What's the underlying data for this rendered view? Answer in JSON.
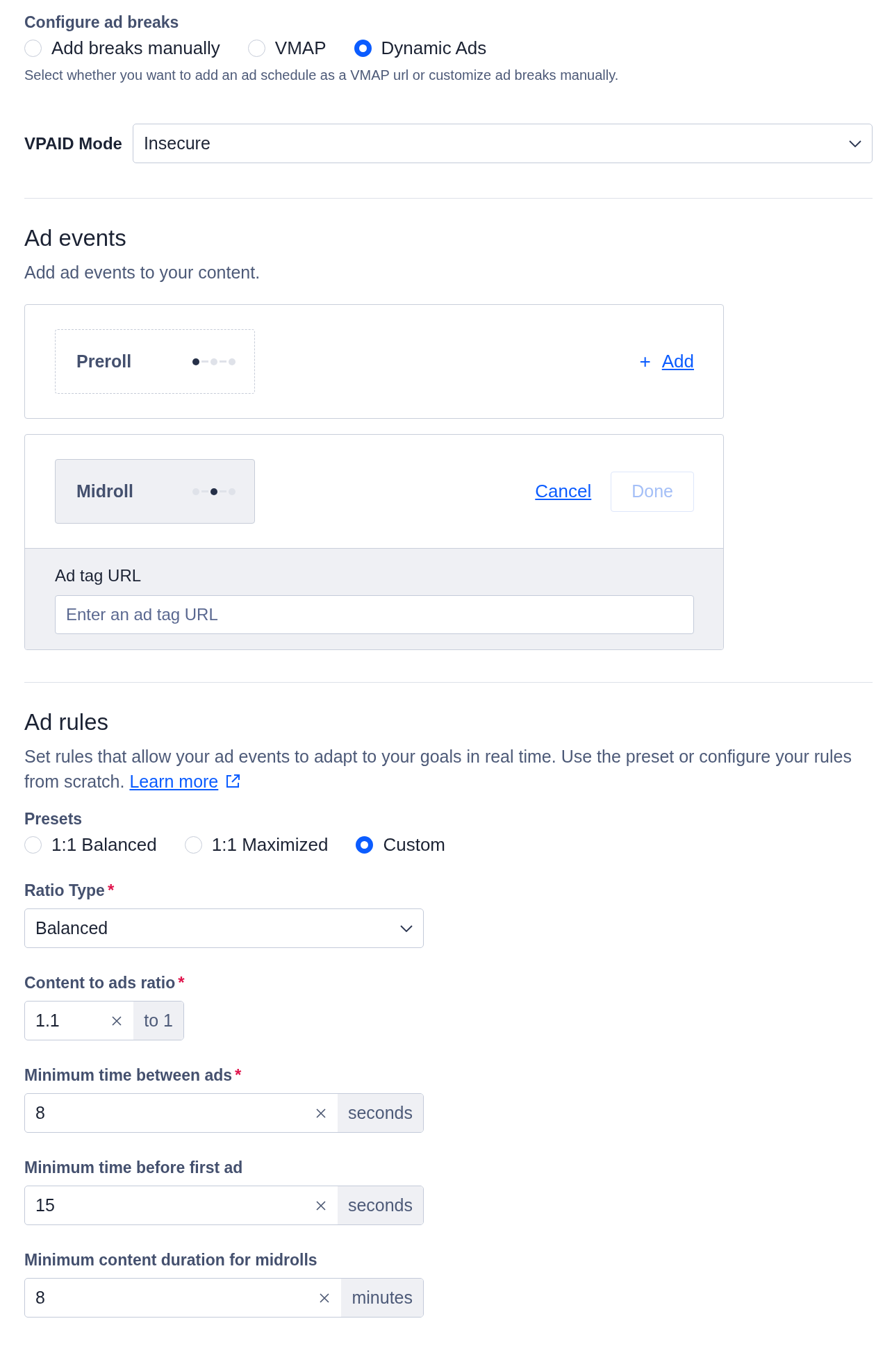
{
  "ad_breaks": {
    "label": "Configure ad breaks",
    "options": [
      {
        "label": "Add breaks manually",
        "selected": false
      },
      {
        "label": "VMAP",
        "selected": false
      },
      {
        "label": "Dynamic Ads",
        "selected": true
      }
    ],
    "help": "Select whether you want to add an ad schedule as a VMAP url or customize ad breaks manually."
  },
  "vpaid": {
    "label": "VPAID Mode",
    "value": "Insecure"
  },
  "ad_events": {
    "title": "Ad events",
    "subtitle": "Add ad events to your content.",
    "events": [
      {
        "name": "Preroll",
        "expanded": false,
        "dots": [
          {
            "selected": true
          },
          {
            "selected": false
          },
          {
            "selected": false
          }
        ],
        "add_icon": "+",
        "add_label": "Add"
      },
      {
        "name": "Midroll",
        "expanded": true,
        "dots": [
          {
            "selected": false
          },
          {
            "selected": true
          },
          {
            "selected": false
          }
        ],
        "cancel_label": "Cancel",
        "done": {
          "label": "Done",
          "disabled": true
        },
        "field": {
          "label": "Ad tag URL",
          "placeholder": "Enter an ad tag URL"
        }
      }
    ]
  },
  "ad_rules": {
    "title": "Ad rules",
    "description": "Set rules that allow your ad events to adapt to your goals in real time. Use the preset or configure your rules from scratch.",
    "learn_more": "Learn more",
    "presets": {
      "label": "Presets",
      "options": [
        {
          "label": "1:1 Balanced",
          "selected": false
        },
        {
          "label": "1:1 Maximized",
          "selected": false
        },
        {
          "label": "Custom",
          "selected": true
        }
      ]
    },
    "fields": [
      {
        "kind": "select",
        "label": "Ratio Type",
        "required_mark": "*",
        "value": "Balanced"
      },
      {
        "kind": "ratio",
        "label": "Content to ads ratio",
        "required_mark": "*",
        "value": "1.1",
        "suffix": "to 1"
      },
      {
        "kind": "number",
        "label": "Minimum time between ads",
        "required_mark": "*",
        "value": "8",
        "suffix": "seconds"
      },
      {
        "kind": "number",
        "label": "Minimum time before first ad",
        "value": "15",
        "suffix": "seconds"
      },
      {
        "kind": "number",
        "label": "Minimum content duration for midrolls",
        "value": "8",
        "suffix": "minutes"
      }
    ]
  }
}
